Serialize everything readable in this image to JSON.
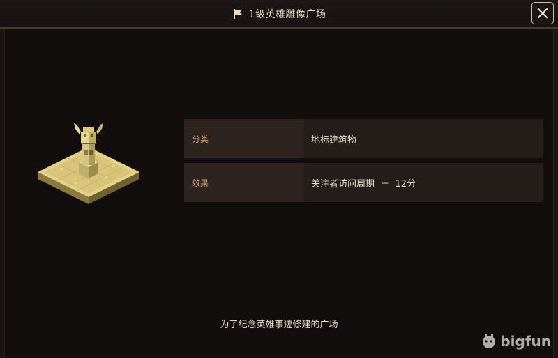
{
  "window": {
    "title": "1级英雄雕像广场"
  },
  "icons": {
    "title": "flag-icon",
    "close": "close-icon",
    "building": "hero-statue-building"
  },
  "info": {
    "rows": [
      {
        "key": "分类",
        "value": "地标建筑物"
      },
      {
        "key": "效果",
        "value": "关注者访问周期  －  12分"
      }
    ]
  },
  "description": "为了纪念英雄事迹修建的广场",
  "watermark": "bigfun",
  "colors": {
    "label_text": "#d9a876",
    "value_text": "#e8dcc6",
    "background": "#120e0d"
  }
}
